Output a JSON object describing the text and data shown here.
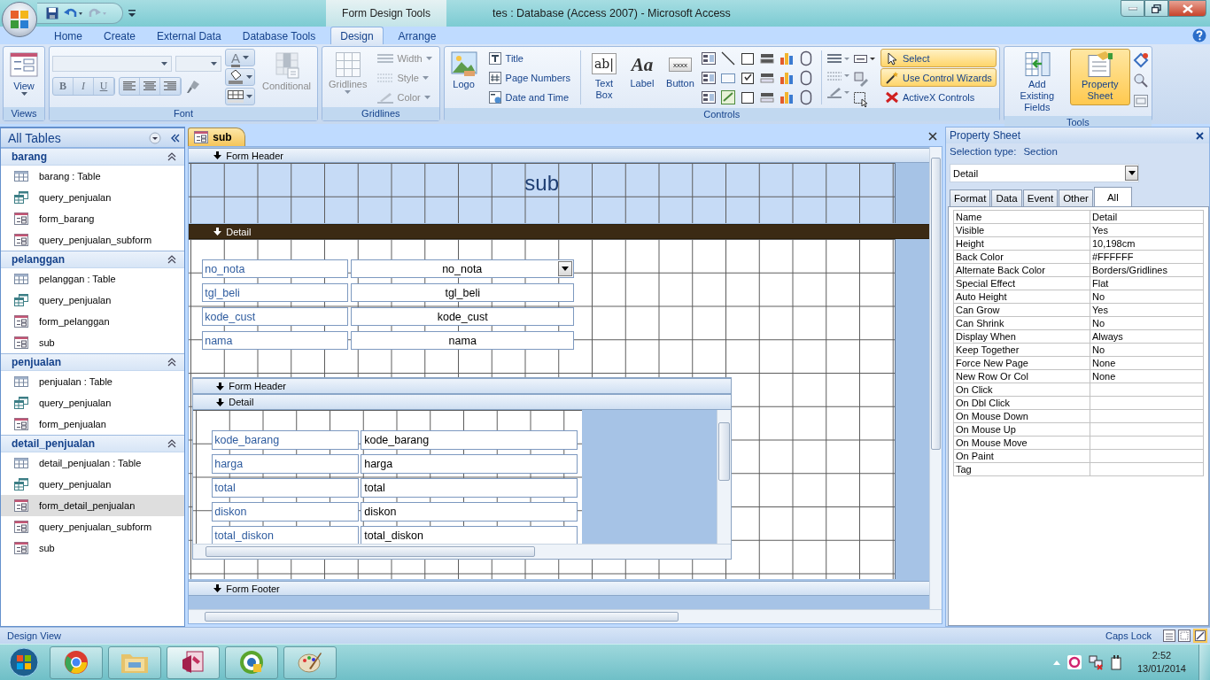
{
  "window": {
    "title": "tes : Database (Access 2007)  -  Microsoft Access",
    "contextual_tab_group": "Form Design Tools"
  },
  "ribbon_tabs": [
    {
      "label": "Home",
      "selected": false
    },
    {
      "label": "Create",
      "selected": false
    },
    {
      "label": "External Data",
      "selected": false
    },
    {
      "label": "Database Tools",
      "selected": false
    },
    {
      "label": "Design",
      "selected": true
    },
    {
      "label": "Arrange",
      "selected": false
    }
  ],
  "ribbon": {
    "views": {
      "label": "Views",
      "view_button": "View"
    },
    "font": {
      "label": "Font",
      "font_color_glyph": "A",
      "format_buttons": [
        "B",
        "I",
        "U"
      ],
      "conditional_button": {
        "label": "Conditional",
        "disabled": true
      }
    },
    "gridlines": {
      "label": "Gridlines",
      "gridlines_button": {
        "label": "Gridlines",
        "disabled": true
      },
      "options": [
        {
          "label": "Width",
          "disabled": true
        },
        {
          "label": "Style",
          "disabled": true
        },
        {
          "label": "Color",
          "disabled": true
        }
      ]
    },
    "controls": {
      "label": "Controls",
      "logo_button": "Logo",
      "header_buttons": [
        "Title",
        "Page Numbers",
        "Date and Time"
      ],
      "control_buttons": [
        {
          "label": "Text Box",
          "glyph": "ab|"
        },
        {
          "label": "Label",
          "glyph": "Aa"
        },
        {
          "label": "Button",
          "glyph": "xxxx"
        }
      ],
      "toggles": [
        {
          "label": "Select",
          "selected": true
        },
        {
          "label": "Use Control Wizards",
          "selected": true
        },
        {
          "label": "ActiveX Controls",
          "selected": false
        }
      ]
    },
    "tools": {
      "label": "Tools",
      "buttons": [
        {
          "label": "Add Existing Fields",
          "selected": false
        },
        {
          "label": "Property Sheet",
          "selected": true
        }
      ]
    }
  },
  "navigation_pane": {
    "title": "All Tables",
    "groups": [
      {
        "name": "barang",
        "expanded": true,
        "items": [
          {
            "label": "barang : Table",
            "kind": "table",
            "selected": false
          },
          {
            "label": "query_penjualan",
            "kind": "query",
            "selected": false
          },
          {
            "label": "form_barang",
            "kind": "form",
            "selected": false
          },
          {
            "label": "query_penjualan_subform",
            "kind": "form",
            "selected": false
          }
        ]
      },
      {
        "name": "pelanggan",
        "expanded": true,
        "items": [
          {
            "label": "pelanggan : Table",
            "kind": "table",
            "selected": false
          },
          {
            "label": "query_penjualan",
            "kind": "query",
            "selected": false
          },
          {
            "label": "form_pelanggan",
            "kind": "form",
            "selected": false
          },
          {
            "label": "sub",
            "kind": "form",
            "selected": false
          }
        ]
      },
      {
        "name": "penjualan",
        "expanded": true,
        "items": [
          {
            "label": "penjualan : Table",
            "kind": "table",
            "selected": false
          },
          {
            "label": "query_penjualan",
            "kind": "query",
            "selected": false
          },
          {
            "label": "form_penjualan",
            "kind": "form",
            "selected": false
          }
        ]
      },
      {
        "name": "detail_penjualan",
        "expanded": true,
        "items": [
          {
            "label": "detail_penjualan : Table",
            "kind": "table",
            "selected": false
          },
          {
            "label": "query_penjualan",
            "kind": "query",
            "selected": false
          },
          {
            "label": "form_detail_penjualan",
            "kind": "form",
            "selected": true
          },
          {
            "label": "query_penjualan_subform",
            "kind": "form",
            "selected": false
          },
          {
            "label": "sub",
            "kind": "form",
            "selected": false
          }
        ]
      }
    ]
  },
  "document_tabs": [
    {
      "label": "sub",
      "selected": true
    }
  ],
  "form": {
    "header": {
      "bar": "Form Header",
      "selected": false,
      "title": "sub"
    },
    "detail": {
      "bar": "Detail",
      "selected": true,
      "fields": [
        {
          "label": "no_nota",
          "value": "no_nota",
          "kind": "combo"
        },
        {
          "label": "tgl_beli",
          "value": "tgl_beli",
          "kind": "text"
        },
        {
          "label": "kode_cust",
          "value": "kode_cust",
          "kind": "text"
        },
        {
          "label": "nama",
          "value": "nama",
          "kind": "text"
        }
      ]
    },
    "subform": {
      "header_bar": {
        "label": "Form Header",
        "selected": false
      },
      "detail_bar": {
        "label": "Detail",
        "selected": false
      },
      "fields": [
        {
          "label": "kode_barang",
          "value": "kode_barang"
        },
        {
          "label": "harga",
          "value": "harga"
        },
        {
          "label": "total",
          "value": "total"
        },
        {
          "label": "diskon",
          "value": "diskon"
        },
        {
          "label": "total_diskon",
          "value": "total_diskon"
        }
      ]
    },
    "footer": {
      "bar": "Form Footer",
      "selected": false
    }
  },
  "property_sheet": {
    "title": "Property Sheet",
    "selection_type_label": "Selection type:",
    "selection_type": "Section",
    "object": "Detail",
    "tabs": [
      {
        "label": "Format",
        "selected": false
      },
      {
        "label": "Data",
        "selected": false
      },
      {
        "label": "Event",
        "selected": false
      },
      {
        "label": "Other",
        "selected": false
      },
      {
        "label": "All",
        "selected": true
      }
    ],
    "properties": [
      {
        "name": "Name",
        "value": "Detail"
      },
      {
        "name": "Visible",
        "value": "Yes"
      },
      {
        "name": "Height",
        "value": "10,198cm"
      },
      {
        "name": "Back Color",
        "value": "#FFFFFF"
      },
      {
        "name": "Alternate Back Color",
        "value": "Borders/Gridlines"
      },
      {
        "name": "Special Effect",
        "value": "Flat"
      },
      {
        "name": "Auto Height",
        "value": "No"
      },
      {
        "name": "Can Grow",
        "value": "Yes"
      },
      {
        "name": "Can Shrink",
        "value": "No"
      },
      {
        "name": "Display When",
        "value": "Always"
      },
      {
        "name": "Keep Together",
        "value": "No"
      },
      {
        "name": "Force New Page",
        "value": "None"
      },
      {
        "name": "New Row Or Col",
        "value": "None"
      },
      {
        "name": "On Click"
      },
      {
        "name": "On Dbl Click"
      },
      {
        "name": "On Mouse Down"
      },
      {
        "name": "On Mouse Up"
      },
      {
        "name": "On Mouse Move"
      },
      {
        "name": "On Paint"
      },
      {
        "name": "Tag"
      }
    ]
  },
  "status_bar": {
    "view": "Design View",
    "indicator": "Caps Lock"
  },
  "taskbar": {
    "time": "2:52",
    "date": "13/01/2014"
  }
}
